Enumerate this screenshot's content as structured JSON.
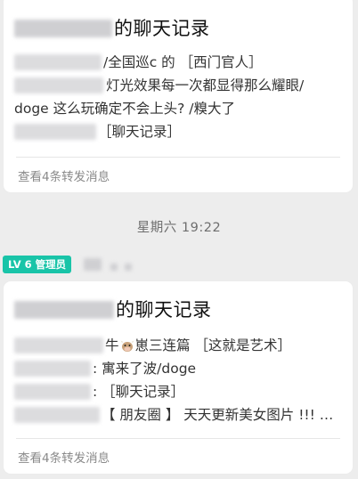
{
  "card1": {
    "title": "的聊天记录",
    "lines": [
      "/全国巡c 的 ［西门官人］",
      "灯光效果每一次都显得那么耀眼/",
      "doge 这么玩确定不会上头? /糗大了",
      "［聊天记录］"
    ],
    "footer": "查看4条转发消息"
  },
  "timestamp": "星期六 19:22",
  "sender": {
    "level_badge": "LV 6 管理员"
  },
  "card2": {
    "title": "的聊天记录",
    "line1_prefix": "牛",
    "line1_suffix": "崽三连篇 ［这就是艺术］",
    "line2": ": 寓来了波/doge",
    "line3": ": ［聊天记录］",
    "line4": "【 朋友圈 】 天天更新美女图片 !!! …",
    "footer": "查看4条转发消息"
  },
  "colors": {
    "background": "#ededed",
    "card": "#ffffff",
    "badge": "#19c4a8",
    "muted_text": "#8a8a8a"
  },
  "icons": {
    "cow_face": "cow-face-emoji-icon"
  }
}
